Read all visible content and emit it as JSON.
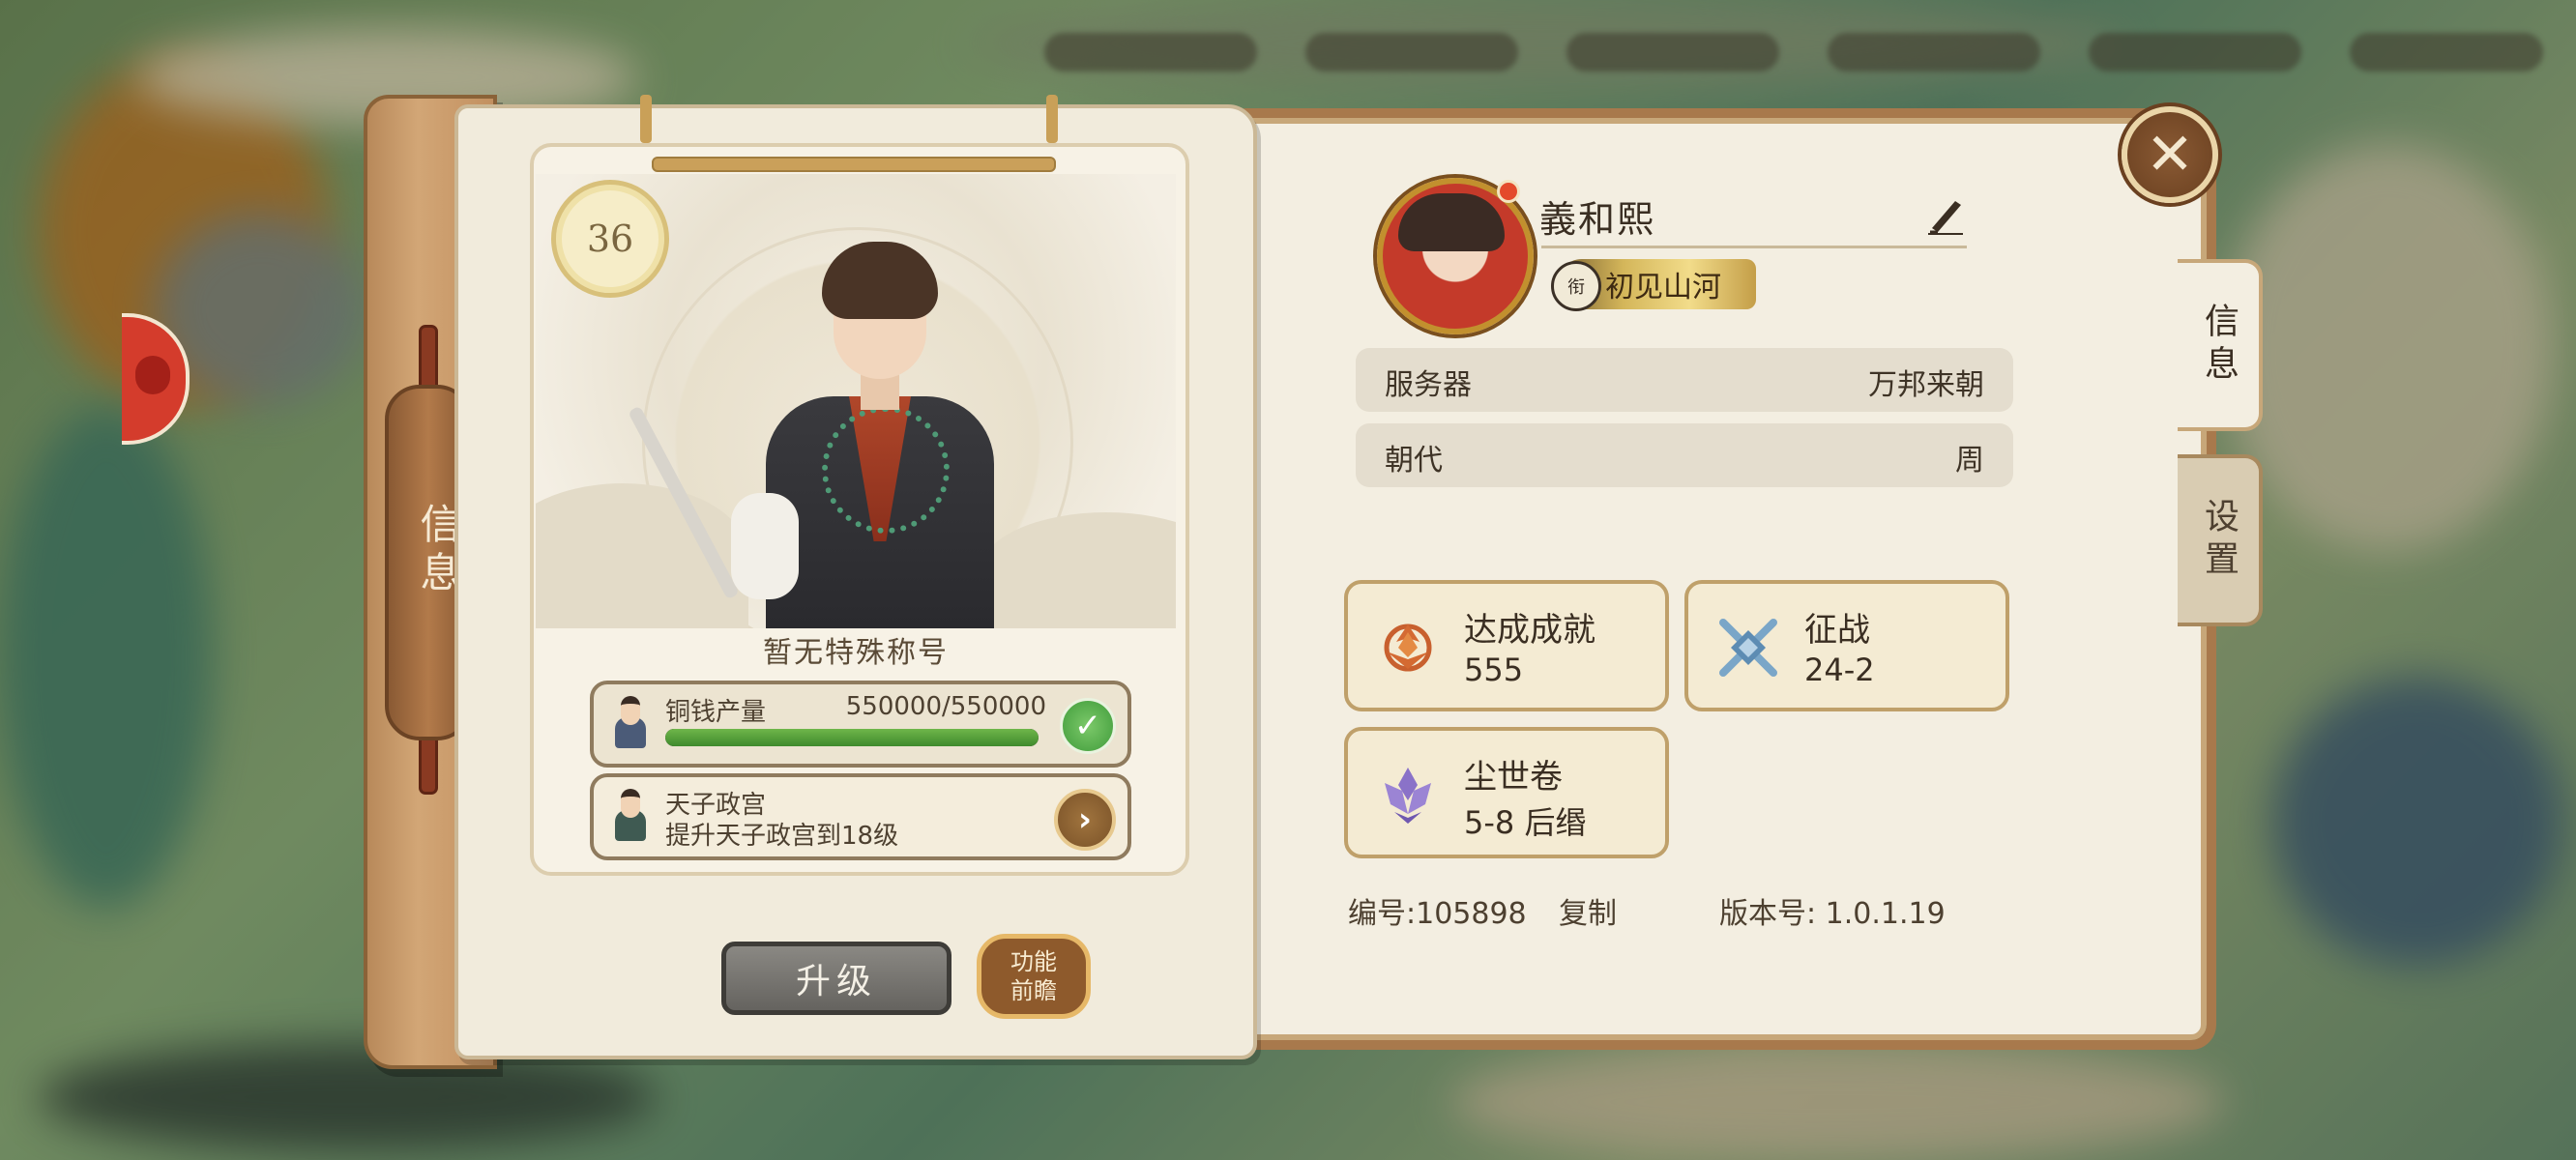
{
  "left_panel": {
    "spine_label": "信息",
    "level": "36",
    "special_title": "暂无特殊称号",
    "tasks": [
      {
        "title": "铜钱产量",
        "value": "550000/550000",
        "progress": 1.0,
        "status": "complete"
      },
      {
        "title": "天子政宫",
        "subtitle": "提升天子政宫到18级",
        "status": "go"
      }
    ],
    "upgrade_label": "升级",
    "preview_label_line1": "功能",
    "preview_label_line2": "前瞻"
  },
  "profile": {
    "name": "義和熙",
    "title_badge": "初见山河",
    "title_seal": "衔"
  },
  "info_rows": [
    {
      "key": "服务器",
      "value": "万邦来朝"
    },
    {
      "key": "朝代",
      "value": "周"
    }
  ],
  "stats": [
    {
      "label": "达成成就",
      "value": "555",
      "icon": "phoenix-icon"
    },
    {
      "label": "征战",
      "value": "24-2",
      "icon": "crossed-swords-icon"
    },
    {
      "label": "尘世卷",
      "value": "5-8 后缗",
      "icon": "lotus-icon"
    }
  ],
  "footer": {
    "id_label": "编号:105898",
    "copy_label": "复制",
    "version_label": "版本号: 1.0.1.19"
  },
  "tabs": [
    {
      "label": "信息",
      "active": true
    },
    {
      "label": "设置",
      "active": false
    }
  ],
  "close_glyph": "✕",
  "colors": {
    "parchment": "#f3eee1",
    "wood_frame": "#a8794c",
    "progress_green": "#5aa33c",
    "accent_gold": "#c2902e"
  }
}
